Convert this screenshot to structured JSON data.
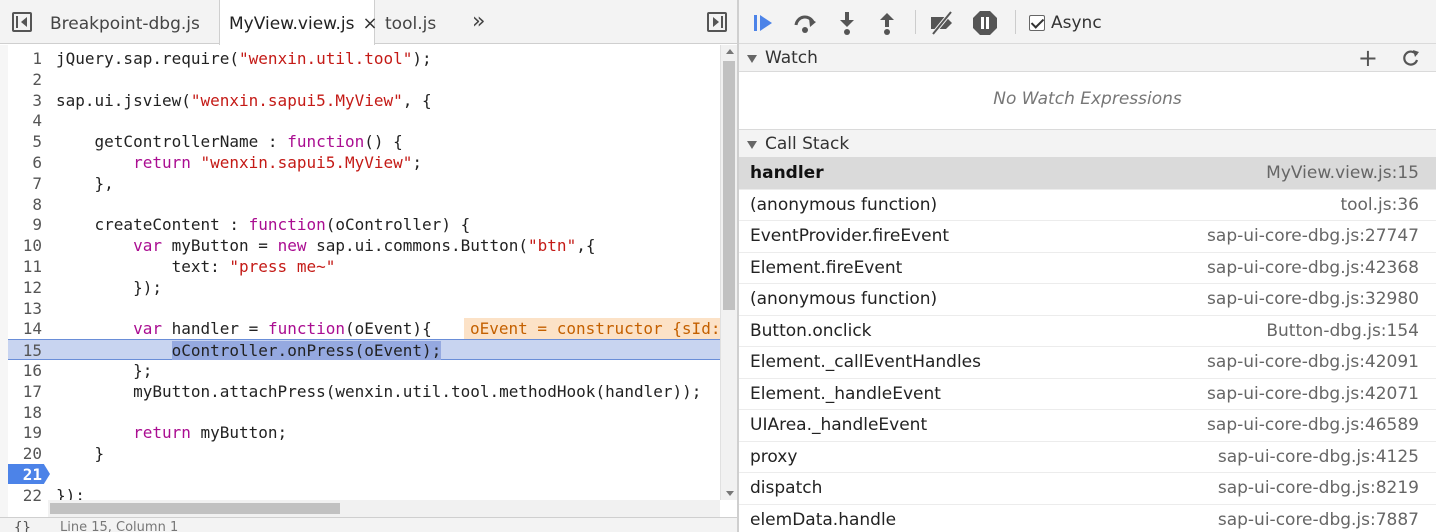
{
  "editor": {
    "tabs": [
      {
        "label": "Breakpoint-dbg.js"
      },
      {
        "label": "MyView.view.js",
        "close": "×"
      },
      {
        "label": "tool.js"
      }
    ],
    "more_label": "»",
    "lines": [
      {
        "num": "1",
        "tokens": [
          {
            "t": "jQuery.sap.require("
          },
          {
            "t": "\"wenxin.util.tool\"",
            "c": "str"
          },
          {
            "t": ");"
          }
        ]
      },
      {
        "num": "2",
        "tokens": []
      },
      {
        "num": "3",
        "tokens": [
          {
            "t": "sap.ui.jsview("
          },
          {
            "t": "\"wenxin.sapui5.MyView\"",
            "c": "str"
          },
          {
            "t": ", {"
          }
        ]
      },
      {
        "num": "4",
        "tokens": []
      },
      {
        "num": "5",
        "tokens": [
          {
            "t": "    getControllerName : "
          },
          {
            "t": "function",
            "c": "kw"
          },
          {
            "t": "() {"
          }
        ]
      },
      {
        "num": "6",
        "tokens": [
          {
            "t": "        "
          },
          {
            "t": "return",
            "c": "kw"
          },
          {
            "t": " "
          },
          {
            "t": "\"wenxin.sapui5.MyView\"",
            "c": "str"
          },
          {
            "t": ";"
          }
        ]
      },
      {
        "num": "7",
        "tokens": [
          {
            "t": "    },"
          }
        ]
      },
      {
        "num": "8",
        "tokens": []
      },
      {
        "num": "9",
        "tokens": [
          {
            "t": "    createContent : "
          },
          {
            "t": "function",
            "c": "kw"
          },
          {
            "t": "(oController) {"
          }
        ]
      },
      {
        "num": "10",
        "tokens": [
          {
            "t": "        "
          },
          {
            "t": "var",
            "c": "kw"
          },
          {
            "t": " myButton = "
          },
          {
            "t": "new",
            "c": "kw"
          },
          {
            "t": " sap.ui.commons.Button("
          },
          {
            "t": "\"btn\"",
            "c": "str"
          },
          {
            "t": ",{"
          }
        ]
      },
      {
        "num": "11",
        "tokens": [
          {
            "t": "            text: "
          },
          {
            "t": "\"press me~\"",
            "c": "str"
          }
        ]
      },
      {
        "num": "12",
        "tokens": [
          {
            "t": "        });"
          }
        ]
      },
      {
        "num": "13",
        "tokens": []
      },
      {
        "num": "14",
        "tokens": [
          {
            "t": "        "
          },
          {
            "t": "var",
            "c": "kw"
          },
          {
            "t": " handler = "
          },
          {
            "t": "function",
            "c": "kw"
          },
          {
            "t": "(oEvent){"
          }
        ],
        "inline": "oEvent = constructor {sId:"
      },
      {
        "num": "15",
        "tokens": [
          {
            "t": "            "
          },
          {
            "t": "oController.onPress(oEvent);",
            "c": "sel"
          }
        ],
        "exec": true
      },
      {
        "num": "16",
        "tokens": [
          {
            "t": "        };"
          }
        ]
      },
      {
        "num": "17",
        "tokens": [
          {
            "t": "        myButton.attachPress(wenxin.util.tool.methodHook(handler));"
          }
        ]
      },
      {
        "num": "18",
        "tokens": []
      },
      {
        "num": "19",
        "tokens": [
          {
            "t": "        "
          },
          {
            "t": "return",
            "c": "kw"
          },
          {
            "t": " myButton;"
          }
        ]
      },
      {
        "num": "20",
        "tokens": [
          {
            "t": "    }"
          }
        ]
      },
      {
        "num": "21",
        "tokens": [],
        "breakpoint": true
      },
      {
        "num": "22",
        "tokens": [
          {
            "t": "});"
          }
        ]
      }
    ],
    "status_braces": "{}",
    "status_coord": "Line 15, Column 1"
  },
  "sidebar": {
    "async_label": "Async",
    "watch": {
      "title": "Watch",
      "empty": "No Watch Expressions",
      "add_label": "+"
    },
    "callstack": {
      "title": "Call Stack",
      "frames": [
        {
          "name": "handler",
          "loc": "MyView.view.js:15",
          "selected": true
        },
        {
          "name": "(anonymous function)",
          "loc": "tool.js:36"
        },
        {
          "name": "EventProvider.fireEvent",
          "loc": "sap-ui-core-dbg.js:27747"
        },
        {
          "name": "Element.fireEvent",
          "loc": "sap-ui-core-dbg.js:42368"
        },
        {
          "name": "(anonymous function)",
          "loc": "sap-ui-core-dbg.js:32980"
        },
        {
          "name": "Button.onclick",
          "loc": "Button-dbg.js:154"
        },
        {
          "name": "Element._callEventHandles",
          "loc": "sap-ui-core-dbg.js:42091"
        },
        {
          "name": "Element._handleEvent",
          "loc": "sap-ui-core-dbg.js:42071"
        },
        {
          "name": "UIArea._handleEvent",
          "loc": "sap-ui-core-dbg.js:46589"
        },
        {
          "name": "proxy",
          "loc": "sap-ui-core-dbg.js:4125"
        },
        {
          "name": "dispatch",
          "loc": "sap-ui-core-dbg.js:8219"
        },
        {
          "name": "elemData.handle",
          "loc": "sap-ui-core-dbg.js:7887"
        }
      ]
    }
  },
  "colors": {
    "accent": "#4c83e8",
    "exec_line": "#c8d4f0",
    "keyword": "#aa0d91",
    "string": "#c41a16",
    "inline_value_bg": "#fce2c7",
    "inline_value_fg": "#c46000"
  },
  "icons": {
    "toggle_navigator": "navigator-toggle-icon",
    "toggle_debugger": "debugger-toggle-icon",
    "resume": "resume-icon",
    "step_over": "step-over-icon",
    "step_into": "step-into-icon",
    "step_out": "step-out-icon",
    "deactivate_breakpoints": "deactivate-breakpoints-icon",
    "pause_exceptions": "pause-on-exceptions-icon",
    "refresh": "refresh-icon"
  }
}
